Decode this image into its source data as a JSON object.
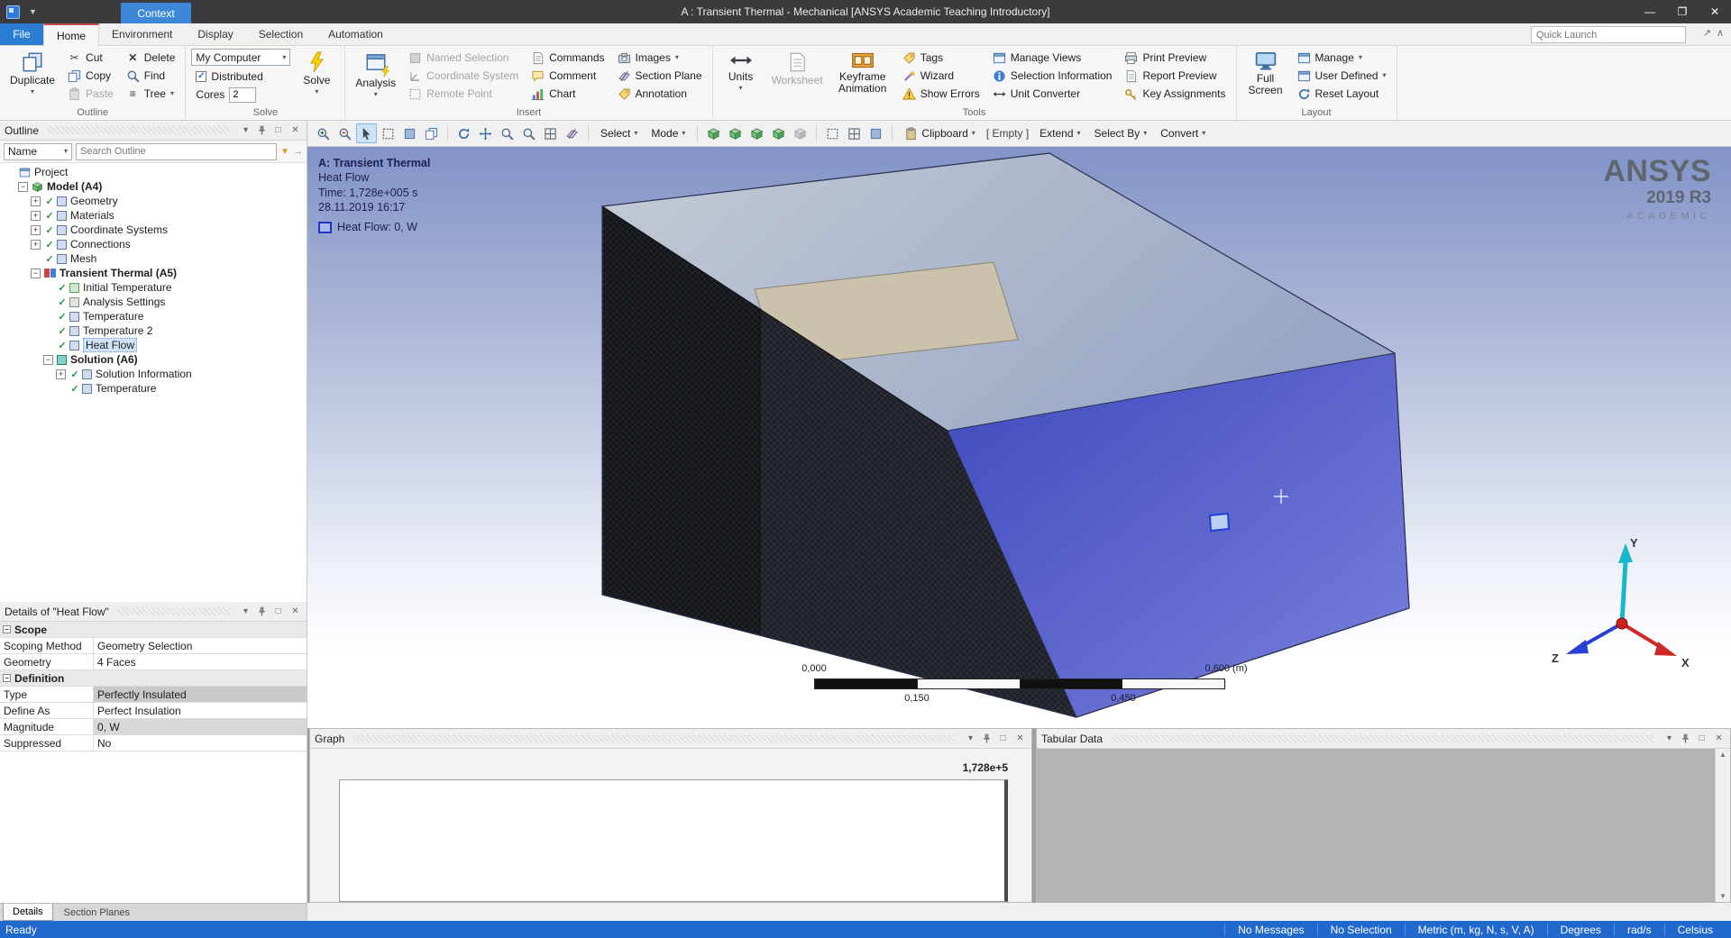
{
  "titlebar": {
    "app_title": "A : Transient Thermal - Mechanical [ANSYS Academic Teaching Introductory]",
    "context_tab": "Context"
  },
  "ribbon": {
    "tabs": [
      "File",
      "Home",
      "Environment",
      "Display",
      "Selection",
      "Automation"
    ],
    "quick_launch_placeholder": "Quick Launch",
    "outline_group": {
      "label": "Outline",
      "duplicate": "Duplicate",
      "cut": "Cut",
      "copy": "Copy",
      "paste": "Paste",
      "delete": "Delete",
      "find": "Find",
      "tree": "Tree"
    },
    "solve_group": {
      "label": "Solve",
      "computer": "My Computer",
      "distributed": "Distributed",
      "cores_label": "Cores",
      "cores_value": "2",
      "solve": "Solve"
    },
    "insert_group": {
      "label": "Insert",
      "analysis": "Analysis",
      "named_selection": "Named Selection",
      "coordinate_system": "Coordinate System",
      "remote_point": "Remote Point",
      "commands": "Commands",
      "comment": "Comment",
      "chart": "Chart",
      "images": "Images",
      "section_pl": "Section Plane",
      "annotation": "Annotation"
    },
    "tools_group": {
      "label": "Tools",
      "units": "Units",
      "worksheet": "Worksheet",
      "keyframe_animation": "Keyframe Animation",
      "tags": "Tags",
      "wizard": "Wizard",
      "show_errors": "Show Errors",
      "manage_views": "Manage Views",
      "selection_information": "Selection Information",
      "unit_converter": "Unit Converter",
      "print_preview": "Print Preview",
      "report_preview": "Report Preview",
      "key_assignments": "Key Assignments"
    },
    "layout_group": {
      "label": "Layout",
      "full_screen": "Full Screen",
      "manage": "Manage",
      "user_defined": "User Defined",
      "reset_layout": "Reset Layout"
    }
  },
  "graphics_toolbar": {
    "select": "Select",
    "mode": "Mode",
    "clipboard": "Clipboard",
    "clipboard_state": "[ Empty ]",
    "extend": "Extend",
    "select_by": "Select By",
    "convert": "Convert"
  },
  "outline_panel": {
    "title": "Outline",
    "name_filter": "Name",
    "search_placeholder": "Search Outline",
    "items": [
      {
        "label": "Project"
      },
      {
        "label": "Model (A4)"
      },
      {
        "label": "Geometry"
      },
      {
        "label": "Materials"
      },
      {
        "label": "Coordinate Systems"
      },
      {
        "label": "Connections"
      },
      {
        "label": "Mesh"
      },
      {
        "label": "Transient Thermal (A5)"
      },
      {
        "label": "Initial Temperature"
      },
      {
        "label": "Analysis Settings"
      },
      {
        "label": "Temperature"
      },
      {
        "label": "Temperature 2"
      },
      {
        "label": "Heat Flow"
      },
      {
        "label": "Solution (A6)"
      },
      {
        "label": "Solution Information"
      },
      {
        "label": "Temperature"
      }
    ]
  },
  "details_panel": {
    "title": "Details of \"Heat Flow\"",
    "sections": {
      "scope": "Scope",
      "definition": "Definition"
    },
    "rows": [
      {
        "key": "Scoping Method",
        "value": "Geometry Selection"
      },
      {
        "key": "Geometry",
        "value": "4 Faces"
      },
      {
        "key": "Type",
        "value": "Perfectly Insulated"
      },
      {
        "key": "Define As",
        "value": "Perfect Insulation"
      },
      {
        "key": "Magnitude",
        "value": "0, W"
      },
      {
        "key": "Suppressed",
        "value": "No"
      }
    ],
    "tabs": [
      "Details",
      "Section Planes"
    ]
  },
  "viewport": {
    "title": "A: Transient Thermal",
    "lines": [
      "Heat Flow",
      "Time: 1,728e+005 s",
      "28.11.2019 16:17"
    ],
    "legend": "Heat Flow: 0, W",
    "logo": {
      "name": "ANSYS",
      "version": "2019 R3",
      "edition": "ACADEMIC"
    },
    "ruler": {
      "top": [
        "0,000",
        "0,300",
        "0,600 (m)"
      ],
      "bottom": [
        "0,150",
        "0,450"
      ]
    },
    "triad": {
      "x": "X",
      "y": "Y",
      "z": "Z"
    }
  },
  "graph_panel": {
    "title": "Graph",
    "time_max": "1,728e+5"
  },
  "tabular_panel": {
    "title": "Tabular Data"
  },
  "statusbar": {
    "ready": "Ready",
    "items": [
      "No Messages",
      "No Selection",
      "Metric (m, kg, N, s, V, A)",
      "Degrees",
      "rad/s",
      "Celsius"
    ]
  }
}
